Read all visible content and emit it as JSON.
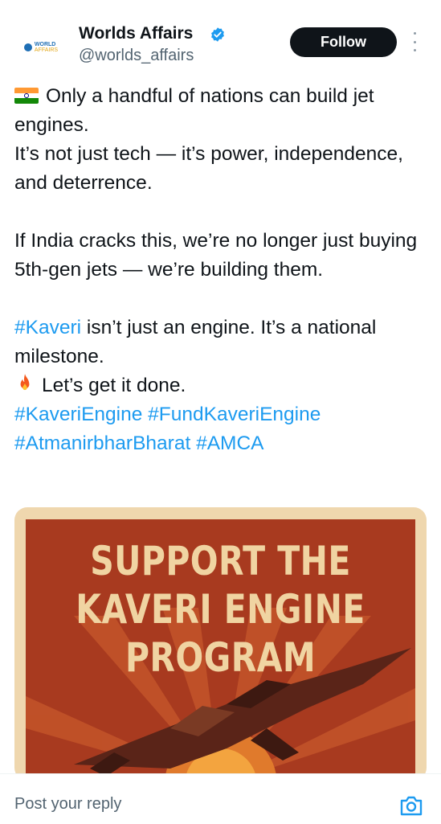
{
  "account": {
    "name": "Worlds Affairs",
    "handle": "@worlds_affairs",
    "logo_line1": "WORLD",
    "logo_line2": "AFFAIRS",
    "verified_icon": "verified-badge-icon"
  },
  "actions": {
    "follow_label": "Follow",
    "more_icon": "more-vertical-icon"
  },
  "tweet": {
    "p1_line1": "Only a handful of nations can build jet engines.",
    "p1_line2": "It’s not just tech — it’s power, independence, and deterrence.",
    "p2": "If India cracks this, we’re no longer just buying 5th-gen jets — we’re building them.",
    "p3_hashtag": "#Kaveri",
    "p3_rest": " isn’t just an engine. It’s a national milestone.",
    "p3_fire_line": "Let’s get it done.",
    "hashtags_line1": "#KaveriEngine #FundKaveriEngine",
    "hashtags_line2": "#AtmanirbharBharat #AMCA",
    "flag_emoji": "india-flag-icon",
    "fire_emoji": "fire-icon"
  },
  "media": {
    "title_line1": "SUPPORT THE",
    "title_line2": "KAVERI ENGINE",
    "title_line3": "PROGRAM"
  },
  "reply": {
    "placeholder": "Post your reply",
    "camera_icon": "camera-icon"
  },
  "colors": {
    "link": "#1d9bf0",
    "follow_bg": "#0f1419",
    "poster_red": "#a83a1f",
    "poster_cream": "#f0d4a2"
  }
}
